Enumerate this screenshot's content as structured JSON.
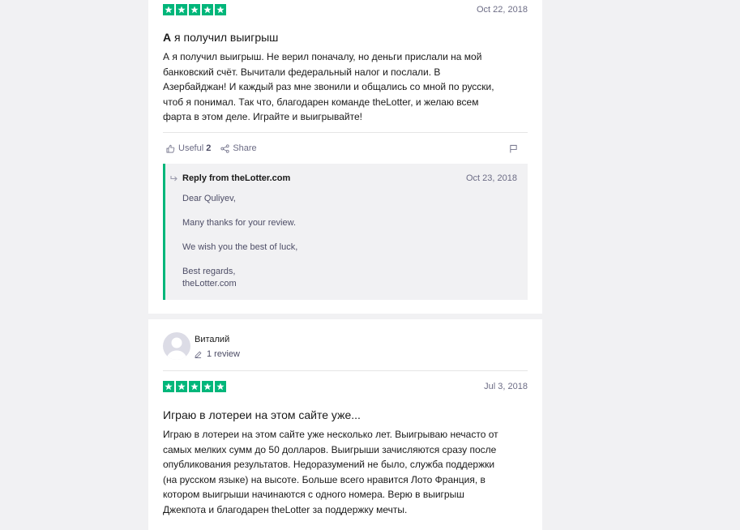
{
  "colors": {
    "star_green": "#00b67a",
    "page_bg": "#f1f1f3",
    "muted_text": "#6c6c85"
  },
  "review1": {
    "rating": 5,
    "date": "Oct 22, 2018",
    "title_first": "А",
    "title_rest": " я получил выигрыш",
    "body": "А я получил выигрыш. Не верил поначалу, но деньги прислали на мой\nбанковский счёт. Вычитали федеральный налог и послали. В\nАзербайджан! И каждый раз мне звонили и общались со мной по русски,\nчтоб я понимал. Так что, благодарен команде theLotter, и желаю всем\nфарта в этом деле. Играйте и выигрывайте!",
    "useful_label": "Useful",
    "useful_count": "2",
    "share_label": "Share",
    "reply": {
      "header": "Reply from theLotter.com",
      "date": "Oct 23, 2018",
      "line1": "Dear Quliyev,",
      "line2": "Many thanks for your review.",
      "line3": "We wish you the best of luck,",
      "line4": "Best regards,",
      "line5": "theLotter.com"
    }
  },
  "review2": {
    "reviewer_name": "Виталий",
    "review_count": "1 review",
    "rating": 5,
    "date": "Jul 3, 2018",
    "title": "Играю в лотереи на этом сайте уже...",
    "body": "Играю в лотереи на этом сайте уже несколько лет. Выигрываю нечасто от\nсамых мелких сумм до 50 долларов. Выигрыши зачисляются сразу после\nопубликования результатов. Недоразумений не было, служба поддержки\n(на русском языке) на высоте. Больше всего нравится Лото Франция, в\nкотором выигрыши начинаются с одного номера. Верю в выигрыш\nДжекпота и благодарен theLotter за поддержку мечты."
  }
}
